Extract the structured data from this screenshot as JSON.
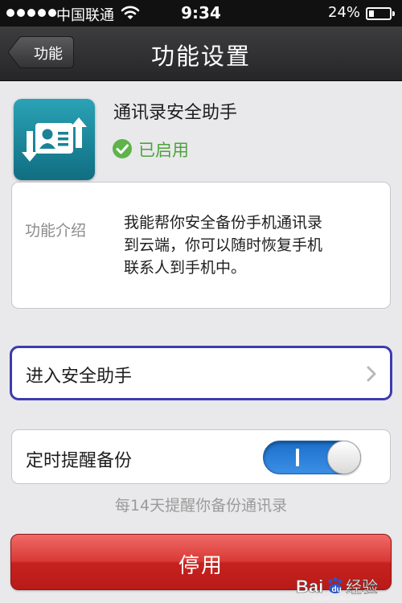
{
  "status_bar": {
    "carrier": "中国联通",
    "time": "9:34",
    "battery": "24%"
  },
  "nav": {
    "back_label": "功能",
    "title": "功能设置"
  },
  "app": {
    "name": "通讯录安全助手",
    "status": "已启用",
    "icon": "contacts-sync-icon"
  },
  "intro": {
    "label": "功能介绍",
    "lines": [
      "我能帮你安全备份手机通讯录",
      "到云端，你可以随时恢复手机",
      "联系人到手机中。"
    ]
  },
  "enter": {
    "label": "进入安全助手"
  },
  "reminder": {
    "label": "定时提醒备份",
    "enabled": true,
    "hint": "每14天提醒你备份通讯录"
  },
  "disable_button": {
    "label": "停用"
  },
  "watermark": {
    "text": "Bai du 经验",
    "url": "jingyan.baidu.com"
  },
  "colors": {
    "enabled_green": "#4da33c",
    "toggle_blue": "#2a82dc",
    "disable_red": "#d33330",
    "highlight_border": "#3e3bb0"
  }
}
